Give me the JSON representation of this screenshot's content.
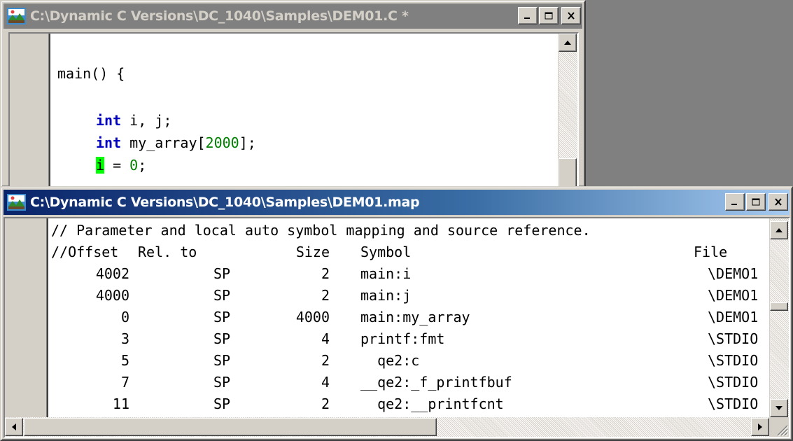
{
  "source_window": {
    "title": "C:\\Dynamic C Versions\\DC_1040\\Samples\\DEM01.C *",
    "icon": "dynamic-c-app-icon",
    "code": {
      "line1": "main() {",
      "line2_kw": "int",
      "line2_rest": " i, j;",
      "line3_kw": "int",
      "line3_pre": " my_array[",
      "line3_num": "2000",
      "line3_post": "];",
      "line4_hl": "i",
      "line4_mid": " = ",
      "line4_num": "0",
      "line4_post": ";"
    }
  },
  "map_window": {
    "title": "C:\\Dynamic C Versions\\DC_1040\\Samples\\DEM01.map",
    "icon": "dynamic-c-app-icon",
    "comment": "// Parameter and local auto symbol mapping and source reference.",
    "headers": {
      "offset": "//Offset",
      "rel": "Rel. to",
      "size": "Size",
      "symbol": "Symbol",
      "file": "File"
    },
    "rows": [
      {
        "offset": "4002",
        "rel": "SP",
        "size": "2",
        "symbol": "main:i",
        "file": "\\DEMO1"
      },
      {
        "offset": "4000",
        "rel": "SP",
        "size": "2",
        "symbol": "main:j",
        "file": "\\DEMO1"
      },
      {
        "offset": "0",
        "rel": "SP",
        "size": "4000",
        "symbol": "main:my_array",
        "file": "\\DEMO1"
      },
      {
        "offset": "3",
        "rel": "SP",
        "size": "4",
        "symbol": "printf:fmt",
        "file": "\\STDIO"
      },
      {
        "offset": "5",
        "rel": "SP",
        "size": "2",
        "symbol": "  qe2:c",
        "file": "\\STDIO"
      },
      {
        "offset": "7",
        "rel": "SP",
        "size": "4",
        "symbol": "__qe2:_f_printfbuf",
        "file": "\\STDIO"
      },
      {
        "offset": "11",
        "rel": "SP",
        "size": "2",
        "symbol": "  qe2:__printfcnt",
        "file": "\\STDIO"
      }
    ]
  },
  "controls": {
    "minimize": "minimize-icon",
    "maximize": "maximize-icon",
    "close": "close-icon"
  }
}
